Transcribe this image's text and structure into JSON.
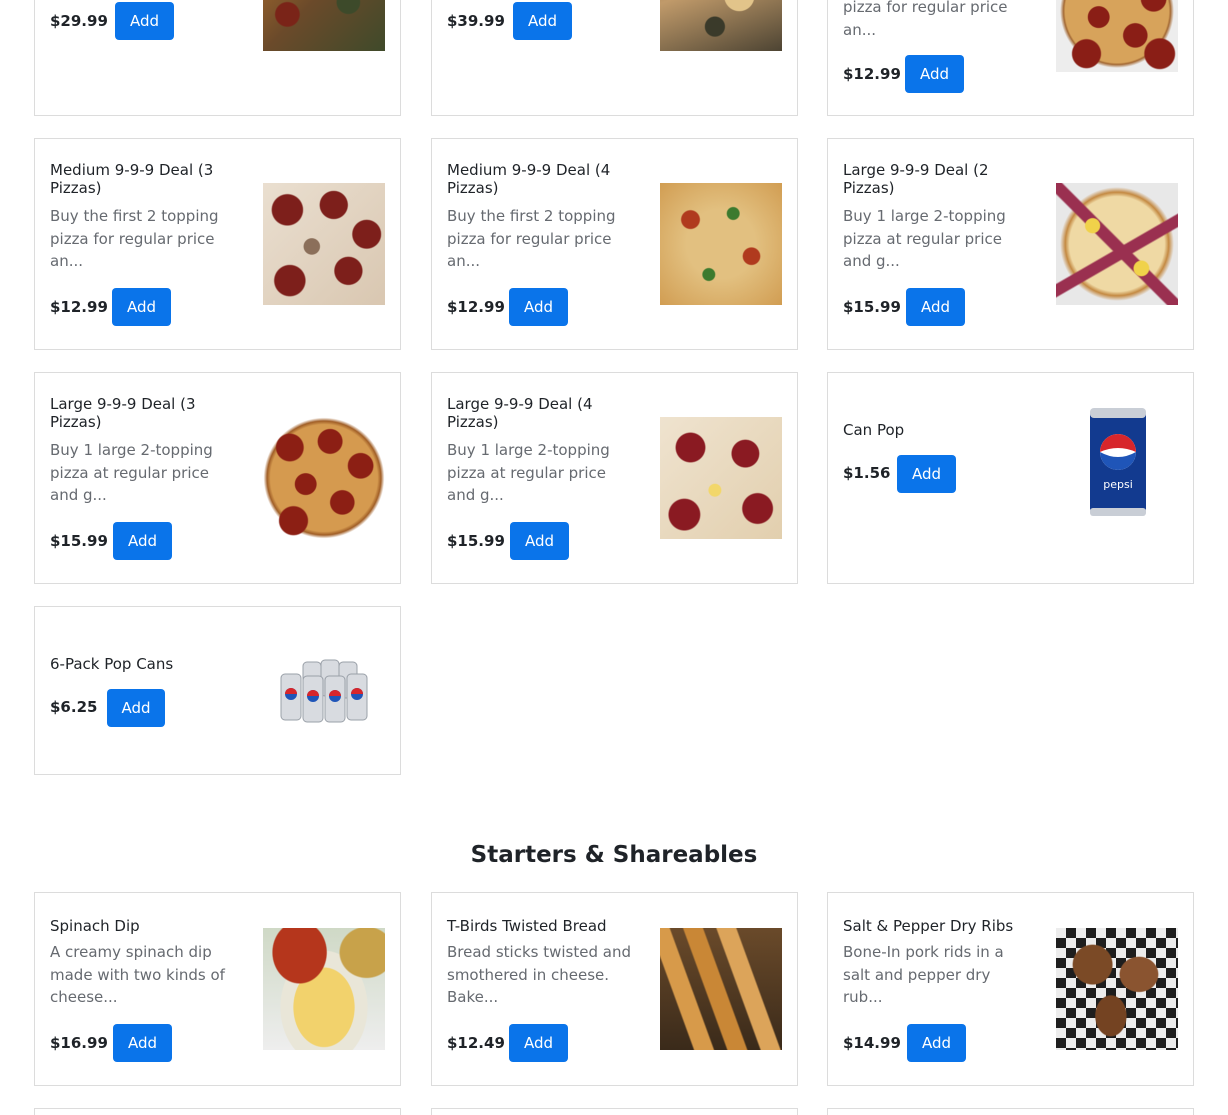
{
  "section": {
    "title": "Starters & Shareables"
  },
  "cards": [
    {
      "price": "$29.99",
      "add": "Add",
      "image": "pizza-thumbnail"
    },
    {
      "price": "$39.99",
      "add": "Add",
      "image": "pizza-thumbnail"
    },
    {
      "desc": "pizza for regular price an...",
      "price": "$12.99",
      "add": "Add",
      "image": "pepperoni-pizza-thumbnail"
    },
    {
      "name": "Medium 9-9-9 Deal (3 Pizzas)",
      "desc": "Buy the first 2 topping pizza for regular price an...",
      "price": "$12.99",
      "add": "Add",
      "image": "pizza-thumbnail"
    },
    {
      "name": "Medium 9-9-9 Deal (4 Pizzas)",
      "desc": "Buy the first 2 topping pizza for regular price an...",
      "price": "$12.99",
      "add": "Add",
      "image": "pizza-thumbnail"
    },
    {
      "name": "Large 9-9-9 Deal (2 Pizzas)",
      "desc": "Buy 1 large 2-topping pizza at regular price and g...",
      "price": "$15.99",
      "add": "Add",
      "image": "pizza-thumbnail"
    },
    {
      "name": "Large 9-9-9 Deal (3 Pizzas)",
      "desc": "Buy 1 large 2-topping pizza at regular price and g...",
      "price": "$15.99",
      "add": "Add",
      "image": "pizza-thumbnail"
    },
    {
      "name": "Large 9-9-9 Deal (4 Pizzas)",
      "desc": "Buy 1 large 2-topping pizza at regular price and g...",
      "price": "$15.99",
      "add": "Add",
      "image": "pizza-thumbnail"
    },
    {
      "name": "Can Pop",
      "price": "$1.56",
      "add": "Add",
      "image": "pepsi-can"
    },
    {
      "name": "6-Pack Pop Cans",
      "price": "$6.25",
      "add": "Add",
      "image": "pepsi-six-pack"
    },
    {
      "name": "Spinach Dip",
      "desc": "A creamy spinach dip made with two kinds of cheese...",
      "price": "$16.99",
      "add": "Add",
      "image": "spinach-dip-thumbnail"
    },
    {
      "name": "T-Birds Twisted Bread",
      "desc": "Bread sticks twisted and smothered in cheese. Bake...",
      "price": "$12.49",
      "add": "Add",
      "image": "twisted-bread-thumbnail"
    },
    {
      "name": "Salt & Pepper Dry Ribs",
      "desc": "Bone-In pork rids in a salt and pepper dry rub...",
      "price": "$14.99",
      "add": "Add",
      "image": "dry-ribs-thumbnail"
    }
  ],
  "colors": {
    "accent": "#0a74ea",
    "border": "#dcdcdc",
    "text": "#1f2328",
    "muted": "#666a70"
  },
  "logo_text": "pepsi"
}
